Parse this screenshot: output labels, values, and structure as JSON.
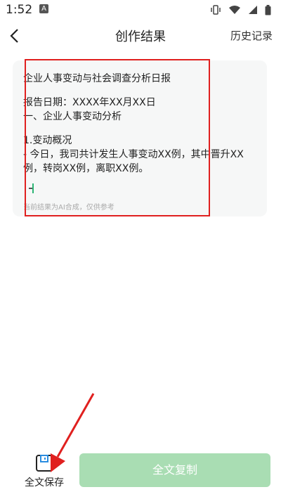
{
  "status_bar": {
    "time": "1:52",
    "notification_letter": "A"
  },
  "header": {
    "title": "创作结果",
    "history_label": "历史记录"
  },
  "result": {
    "lines": [
      "企业人事变动与社会调查分析日报",
      "报告日期：XXXX年XX月XX日",
      "一、企业人事变动分析",
      "1.变动概况",
      "  - 今日，我司共计发生人事变动XX例，其中晋升XX",
      "例，转岗XX例，离职XX例。"
    ],
    "ai_note": "当前结果为AI合成，仅供参考"
  },
  "footer": {
    "save_label": "全文保存",
    "copy_label": "全文复制"
  },
  "colors": {
    "accent": "#a9ddb3",
    "highlight": "#e0201f",
    "card_bg": "#f6f7f7"
  }
}
